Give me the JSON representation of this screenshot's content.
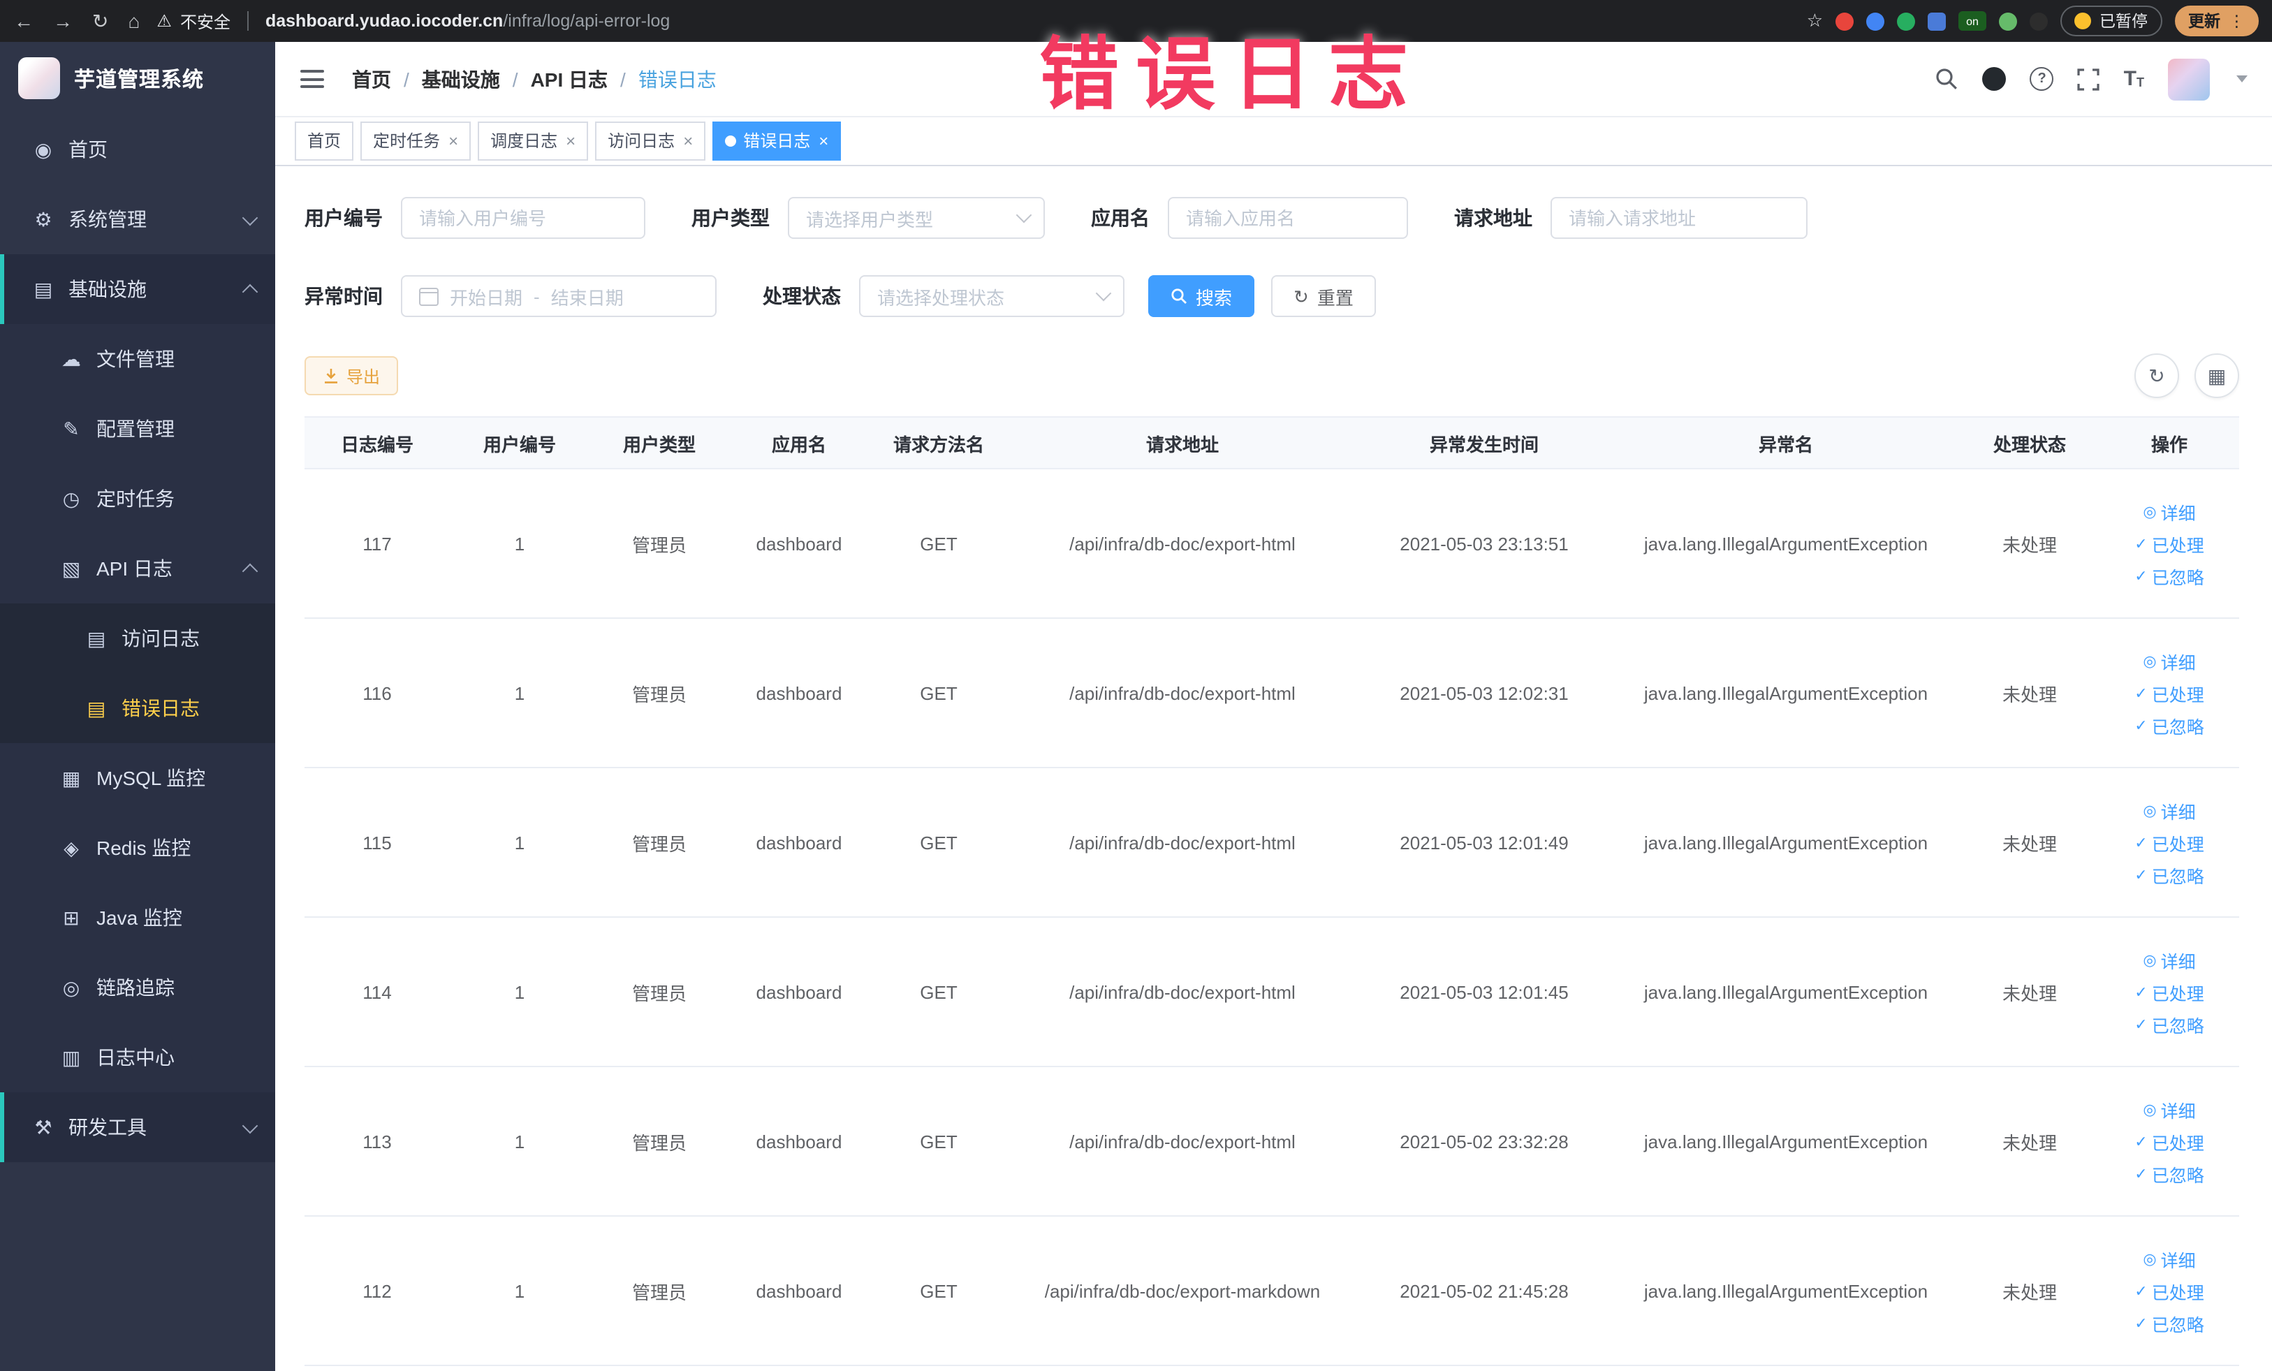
{
  "annotation": "错误日志",
  "browser": {
    "security_label": "不安全",
    "url_host": "dashboard.yudao.iocoder.cn",
    "url_path": "/infra/log/api-error-log",
    "on_badge": "on",
    "paused_badge": "已暂停",
    "update_button": "更新"
  },
  "icons": {
    "back": "←",
    "forward": "→",
    "reload": "↻",
    "home": "⌂",
    "warning": "⚠",
    "star": "☆",
    "kebab": "⋮",
    "close": "×",
    "question": "?",
    "font_large": "T",
    "font_small": "T",
    "eye": "◎",
    "check": "✓",
    "refresh": "↻",
    "columns": "▦",
    "download": "↓",
    "reset": "↻"
  },
  "sidebar": {
    "logo_title": "芋道管理系统",
    "items": [
      {
        "label": "首页",
        "icon": "◉"
      },
      {
        "label": "系统管理",
        "icon": "⚙"
      },
      {
        "label": "基础设施",
        "icon": "▤"
      },
      {
        "label": "文件管理",
        "icon": "☁"
      },
      {
        "label": "配置管理",
        "icon": "✎"
      },
      {
        "label": "定时任务",
        "icon": "◷"
      },
      {
        "label": "API 日志",
        "icon": "▧"
      },
      {
        "label": "访问日志",
        "icon": "▤"
      },
      {
        "label": "错误日志",
        "icon": "▤"
      },
      {
        "label": "MySQL 监控",
        "icon": "▦"
      },
      {
        "label": "Redis 监控",
        "icon": "◈"
      },
      {
        "label": "Java 监控",
        "icon": "⊞"
      },
      {
        "label": "链路追踪",
        "icon": "◎"
      },
      {
        "label": "日志中心",
        "icon": "▥"
      },
      {
        "label": "研发工具",
        "icon": "⚒"
      }
    ]
  },
  "breadcrumb": {
    "items": [
      "首页",
      "基础设施",
      "API 日志",
      "错误日志"
    ]
  },
  "tabs": {
    "items": [
      {
        "label": "首页"
      },
      {
        "label": "定时任务"
      },
      {
        "label": "调度日志"
      },
      {
        "label": "访问日志"
      },
      {
        "label": "错误日志"
      }
    ]
  },
  "filters": {
    "user_id_label": "用户编号",
    "user_id_placeholder": "请输入用户编号",
    "user_type_label": "用户类型",
    "user_type_placeholder": "请选择用户类型",
    "app_label": "应用名",
    "app_placeholder": "请输入应用名",
    "url_label": "请求地址",
    "url_placeholder": "请输入请求地址",
    "time_label": "异常时间",
    "time_start_placeholder": "开始日期",
    "time_separator": "-",
    "time_end_placeholder": "结束日期",
    "status_label": "处理状态",
    "status_placeholder": "请选择处理状态",
    "search_label": "搜索",
    "reset_label": "重置"
  },
  "toolbar": {
    "export_label": "导出"
  },
  "table": {
    "headers": [
      "日志编号",
      "用户编号",
      "用户类型",
      "应用名",
      "请求方法名",
      "请求地址",
      "异常发生时间",
      "异常名",
      "处理状态",
      "操作"
    ],
    "actions": {
      "detail": "详细",
      "processed": "已处理",
      "ignored": "已忽略"
    },
    "rows": [
      {
        "id": "117",
        "user_id": "1",
        "user_type": "管理员",
        "app": "dashboard",
        "method": "GET",
        "url": "/api/infra/db-doc/export-html",
        "time": "2021-05-03 23:13:51",
        "exception": "java.lang.IllegalArgumentException",
        "status": "未处理"
      },
      {
        "id": "116",
        "user_id": "1",
        "user_type": "管理员",
        "app": "dashboard",
        "method": "GET",
        "url": "/api/infra/db-doc/export-html",
        "time": "2021-05-03 12:02:31",
        "exception": "java.lang.IllegalArgumentException",
        "status": "未处理"
      },
      {
        "id": "115",
        "user_id": "1",
        "user_type": "管理员",
        "app": "dashboard",
        "method": "GET",
        "url": "/api/infra/db-doc/export-html",
        "time": "2021-05-03 12:01:49",
        "exception": "java.lang.IllegalArgumentException",
        "status": "未处理"
      },
      {
        "id": "114",
        "user_id": "1",
        "user_type": "管理员",
        "app": "dashboard",
        "method": "GET",
        "url": "/api/infra/db-doc/export-html",
        "time": "2021-05-03 12:01:45",
        "exception": "java.lang.IllegalArgumentException",
        "status": "未处理"
      },
      {
        "id": "113",
        "user_id": "1",
        "user_type": "管理员",
        "app": "dashboard",
        "method": "GET",
        "url": "/api/infra/db-doc/export-html",
        "time": "2021-05-02 23:32:28",
        "exception": "java.lang.IllegalArgumentException",
        "status": "未处理"
      },
      {
        "id": "112",
        "user_id": "1",
        "user_type": "管理员",
        "app": "dashboard",
        "method": "GET",
        "url": "/api/infra/db-doc/export-markdown",
        "time": "2021-05-02 21:45:28",
        "exception": "java.lang.IllegalArgumentException",
        "status": "未处理"
      }
    ]
  },
  "colors": {
    "primary": "#409eff",
    "annotation": "#f23a60",
    "sidebar_bg": "#2f3548",
    "sidebar_active_text": "#ffd04b",
    "export_warning": "#e6a23c",
    "active_tab_bg": "#409eff"
  }
}
